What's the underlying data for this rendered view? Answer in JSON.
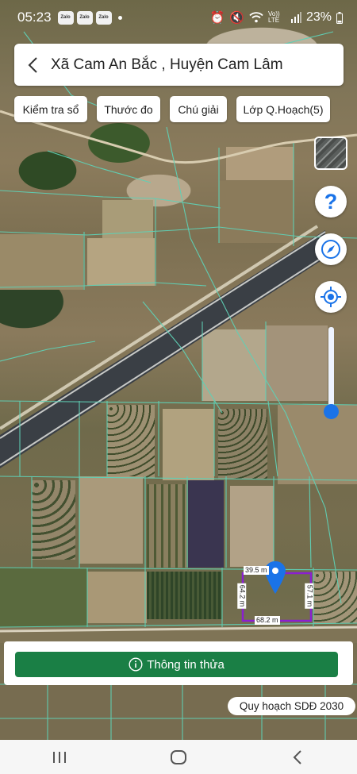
{
  "status_bar": {
    "time": "05:23",
    "notification_apps": [
      "Zalo",
      "Zalo",
      "Zalo"
    ],
    "icons": [
      "alarm-icon",
      "mute-icon",
      "wifi-icon",
      "volte-icon",
      "signal-icon"
    ],
    "volte_label": "Vo)) LTE",
    "battery": "23%"
  },
  "header": {
    "back_icon": "back-arrow-icon",
    "title": "Xã Cam An Bắc , Huyện Cam Lâm"
  },
  "toolbar": {
    "check_book": "Kiểm tra sổ",
    "measure": "Thước đo",
    "legend": "Chú giải",
    "planning_layer": "Lớp Q.Hoạch(5)"
  },
  "map_controls": {
    "layer_thumbnail": "satellite-layer-icon",
    "help": "help-icon",
    "compass": "compass-icon",
    "locate": "my-location-icon",
    "zoom_level": 0.1
  },
  "parcel": {
    "top_edge": "39.5 m",
    "left_edge": "64.2 m",
    "right_edge": "57.1 m",
    "bottom_edge": "68.2 m",
    "outline_color": "#8a1fd1",
    "marker_color": "#1a73e8"
  },
  "info_panel": {
    "button_label": "Thông tin thửa",
    "button_icon": "info-icon",
    "button_color": "#1a7f45"
  },
  "plan_badge": "Quy hoạch SDĐ 2030",
  "nav_bar": {
    "recents": "recents-icon",
    "home": "home-icon",
    "back": "nav-back-icon"
  },
  "colors": {
    "parcel_lines": "#5fd1b6",
    "accent_blue": "#1a73e8"
  }
}
